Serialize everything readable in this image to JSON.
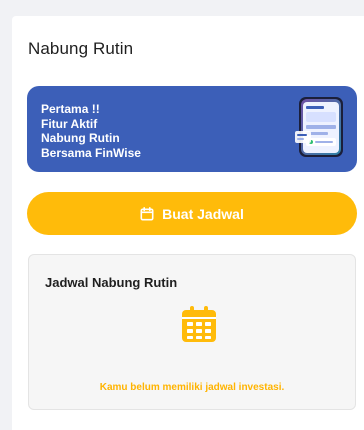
{
  "section": {
    "title": "Nabung Rutin"
  },
  "promo": {
    "lines": [
      "Pertama !!",
      "Fitur Aktif",
      "Nabung Rutin",
      "Bersama FinWise"
    ]
  },
  "cta": {
    "label": "Buat Jadwal",
    "icon": "calendar-icon"
  },
  "schedule": {
    "title": "Jadwal Nabung Rutin",
    "icon": "calendar-grid-icon",
    "empty_text": "Kamu belum memiliki jadwal investasi."
  },
  "colors": {
    "background": "#f1f2f5",
    "promo_bg": "#3c5fb8",
    "accent": "#ffbb0a",
    "empty_text": "#ffb400"
  }
}
